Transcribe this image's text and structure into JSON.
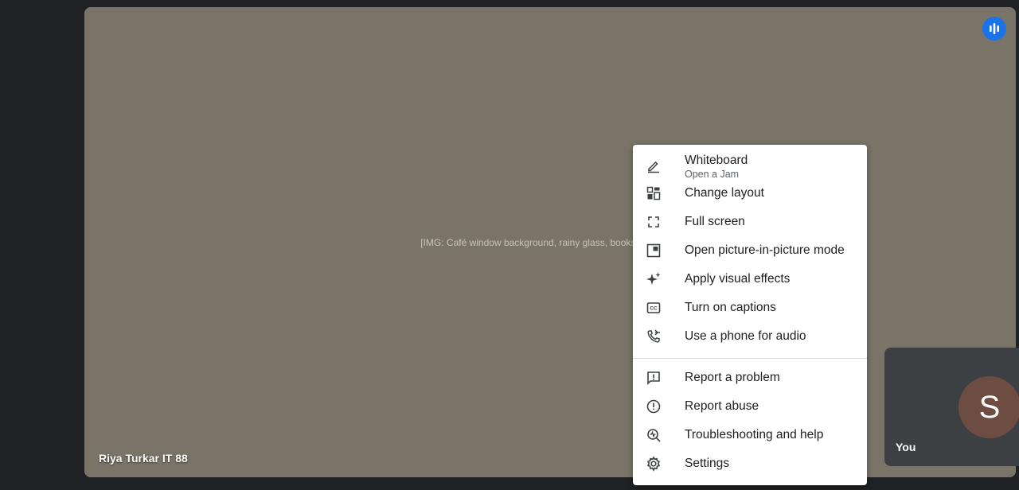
{
  "video": {
    "participant_name": "Riya Turkar IT 88",
    "background_description": "[IMG: Café window background, rainy glass, books and stool]"
  },
  "self_tile": {
    "avatar_letter": "S",
    "label": "You"
  },
  "menu": {
    "items": [
      {
        "label": "Whiteboard",
        "sublabel": "Open a Jam",
        "icon": "pencil-icon"
      },
      {
        "label": "Change layout",
        "icon": "layout-icon"
      },
      {
        "label": "Full screen",
        "icon": "fullscreen-icon"
      },
      {
        "label": "Open picture-in-picture mode",
        "icon": "pip-icon"
      },
      {
        "label": "Apply visual effects",
        "icon": "sparkle-icon"
      },
      {
        "label": "Turn on captions",
        "icon": "captions-icon"
      },
      {
        "label": "Use a phone for audio",
        "icon": "phone-icon"
      },
      {
        "label": "Report a problem",
        "icon": "feedback-icon"
      },
      {
        "label": "Report abuse",
        "icon": "alert-icon"
      },
      {
        "label": "Troubleshooting and help",
        "icon": "troubleshoot-icon"
      },
      {
        "label": "Settings",
        "icon": "gear-icon"
      }
    ]
  },
  "colors": {
    "accent": "#1a73e8",
    "avatar": "#6d4c41",
    "tile": "#3c4043"
  }
}
